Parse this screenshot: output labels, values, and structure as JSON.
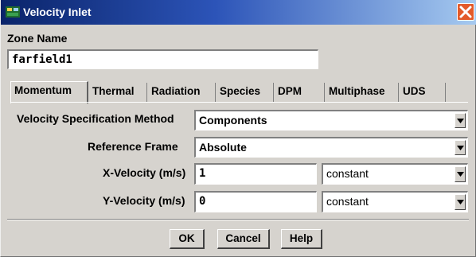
{
  "window": {
    "title": "Velocity Inlet",
    "title_icon": "fluent-panel-icon",
    "close_icon": "close-icon"
  },
  "zone": {
    "label": "Zone Name",
    "value": "farfield1"
  },
  "tabs": [
    {
      "label": "Momentum",
      "active": true
    },
    {
      "label": "Thermal"
    },
    {
      "label": "Radiation"
    },
    {
      "label": "Species"
    },
    {
      "label": "DPM"
    },
    {
      "label": "Multiphase"
    },
    {
      "label": "UDS"
    }
  ],
  "momentum": {
    "spec_method_label": "Velocity Specification Method",
    "spec_method_value": "Components",
    "ref_frame_label": "Reference Frame",
    "ref_frame_value": "Absolute",
    "x_velocity_label": "X-Velocity (m/s)",
    "x_velocity_value": "1",
    "x_velocity_profile": "constant",
    "y_velocity_label": "Y-Velocity (m/s)",
    "y_velocity_value": "0",
    "y_velocity_profile": "constant"
  },
  "buttons": {
    "ok": "OK",
    "cancel": "Cancel",
    "help": "Help"
  },
  "colors": {
    "title_start": "#0a246a",
    "title_end": "#a6caf0",
    "dialog_bg": "#d6d3ce",
    "close": "#e35a2a"
  }
}
